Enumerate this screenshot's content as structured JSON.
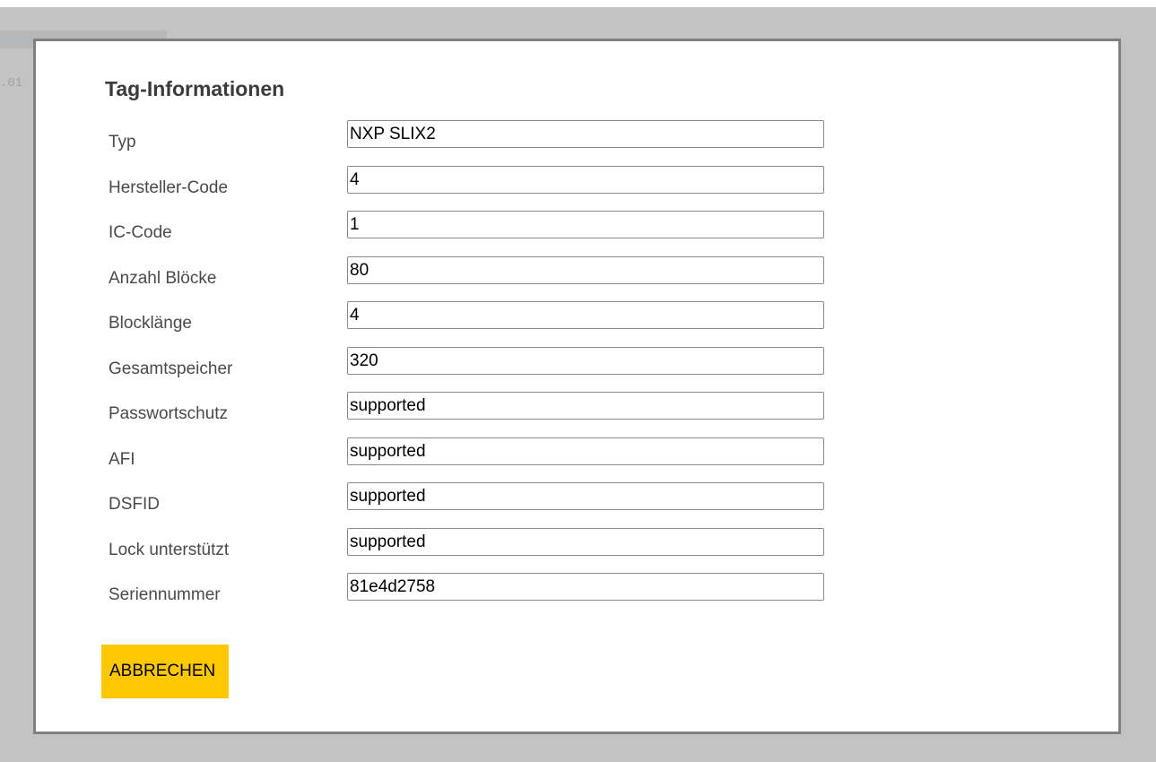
{
  "background": {
    "partial_text": ".01"
  },
  "dialog": {
    "title": "Tag-Informationen",
    "fields": [
      {
        "label": "Typ",
        "value": "NXP SLIX2"
      },
      {
        "label": "Hersteller-Code",
        "value": "4"
      },
      {
        "label": "IC-Code",
        "value": "1"
      },
      {
        "label": "Anzahl Blöcke",
        "value": "80"
      },
      {
        "label": "Blocklänge",
        "value": "4"
      },
      {
        "label": "Gesamtspeicher",
        "value": "320"
      },
      {
        "label": "Passwortschutz",
        "value": "supported"
      },
      {
        "label": "AFI",
        "value": "supported"
      },
      {
        "label": "DSFID",
        "value": "supported"
      },
      {
        "label": "Lock unterstützt",
        "value": "supported"
      },
      {
        "label": "Seriennummer",
        "value": "81e4d2758"
      }
    ],
    "cancel_label": "ABBRECHEN"
  },
  "colors": {
    "backdrop": "#c3c3c3",
    "dialog_border": "#808080",
    "cancel_button": "#ffc800"
  }
}
